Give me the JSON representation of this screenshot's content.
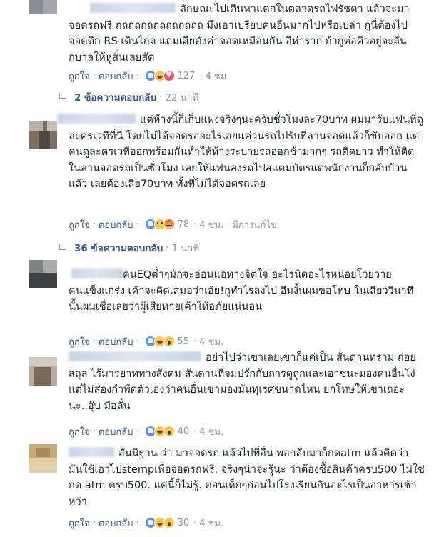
{
  "comments": [
    {
      "text": "ลักษณะไปเดินหาแดกในตลาดรถไฟรัชดา แล้วจะมาจอดรถฟรี ถถถถถถถถถถถถถถ มึงเอาเปรียบคนอื่นมากไปหรือเปล่า กูนี่ต้องไปจอดตึก RS เดินไกล แถมเสียตังค่าจอดเหมือนกัน อีห่าราก ถ้ากูต่อคิวอยู่จะลั่นกบาลให้หูสั่นเลยสัด",
      "like": "ถูกใจ",
      "reply": "ตอบกลับ",
      "count": "127",
      "time": "4 ชม.",
      "edited": "",
      "reactions": [
        "like",
        "haha",
        "love"
      ]
    },
    {
      "text": "แต่ห้างนี้ก็เก็บแพงจริงๆนะครับชั่วโมงละ70บาท ผมมารับแฟนที่ดูละครเวทีที่นี่ โดยไม่ได้จอดรออะไรเลยแค่วนรถไปรับที่ลานจอดแล้วก็ขับออก แต่คนดูละครเวทีออกพร้อมกันทำให้ห้างระบายรถออกช้ามากๆ รถติดยาว ทำให้ติดในลานจอดรถเป็นชั่วโมง เลยให้แฟนลงรถไปสแตมบัตรแต่พนักงานก็กลับบ้านแล้ว เลยต้องเสีย70บาท ทั้งที่ไม่ได้จอดรถเลย",
      "like": "ถูกใจ",
      "reply": "ตอบกลับ",
      "count": "78",
      "time": "4 ชม.",
      "edited": "มีการแก้ไข",
      "reactions": [
        "like",
        "sad",
        "angry"
      ]
    },
    {
      "text": "คนEQต่ำๆมักจะอ่อนแอทางจิตใจ อะไรนิดอะไรหน่อยโวยวาย\nคนแข็งแกร่ง เค้าจะคิดเสมอว่าเอ้ย!กูทำไรลงไป อืมงั้นผมขอโทษ ในเสียววินาทีนั้นผมเชื่อเลยว่าผู้เสียหายเค้าให้อภัยแน่นอน",
      "like": "ถูกใจ",
      "reply": "ตอบกลับ",
      "count": "55",
      "time": "4 ชม.",
      "edited": "",
      "reactions": [
        "like",
        "haha",
        "wow"
      ]
    },
    {
      "text": "อย่าไปว่าเขาเลยเขาก็แค่เป็น สันดานทราม ถ่อย สถุล ไร้มารยาททางสังคม สันดานที่จมปรักกับการดูถูกและเอาชนะมองคนอื่นโง่แต่ไม่ส่องกำพืดตัวเองว่าคนอื่นเขามองมันทุเรศขนาดไหน ยกโทษให้เขาเถอะนะ..อุ๊บ มือลั่น",
      "like": "ถูกใจ",
      "reply": "ตอบกลับ",
      "count": "40",
      "time": "4 ชม.",
      "edited": "",
      "reactions": [
        "like",
        "haha",
        "wow"
      ]
    },
    {
      "text": "สันนิฐาน ว่า มาจอดรถ แล้วไปที่อื่น พอกลับมาก็กดatm แล้วคิดว่า มันใช้เอาไปstempเพื่อจอดรถฟรี. จริงๆน่าจะรู้นะ ว่าต้องซื้อสินค้าครบ500 ไม่ใช่กด atm ครบ500. แค่นี้ก็ไม่รู้. ตอนเด็กๆก่อนไปโรงเรียนกินอะไรเป็นอาหารเช้าหว่า",
      "like": "ถูกใจ",
      "reply": "ตอบกลับ",
      "count": "30",
      "time": "4 ชม.",
      "edited": "",
      "reactions": [
        "like",
        "haha",
        "wow"
      ]
    }
  ],
  "reply_threads": [
    {
      "label": "2 ข้อความตอบกลับ",
      "time": "22 นาที",
      "dot": "·"
    },
    {
      "label": "36 ข้อความตอบกลับ",
      "time": "1 นาที",
      "dot": "·"
    }
  ],
  "sep": "·"
}
